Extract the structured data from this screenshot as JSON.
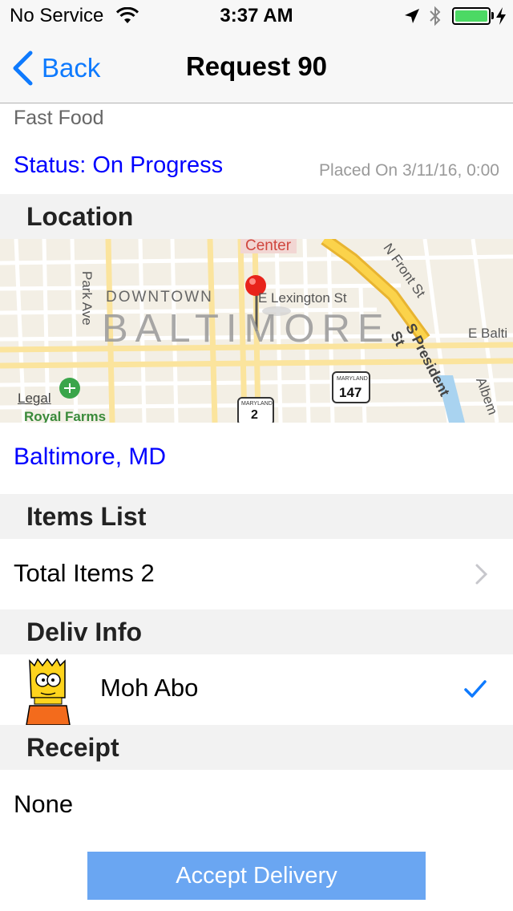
{
  "status_bar": {
    "carrier": "No Service",
    "time": "3:37 AM",
    "battery_color": "#4cd964",
    "icons": [
      "wifi-icon",
      "location-arrow-icon",
      "bluetooth-icon",
      "battery-icon",
      "charging-bolt-icon"
    ]
  },
  "nav": {
    "back_label": "Back",
    "title": "Request 90",
    "tint_color": "#0e7afe"
  },
  "request": {
    "category": "Fast Food",
    "status": "Status: On Progress",
    "placed_on": "Placed On 3/11/16, 0:00"
  },
  "location": {
    "header": "Location",
    "city": "Baltimore, MD",
    "map": {
      "district_label": "DOWNTOWN",
      "city_label": "BALTIMORE",
      "streets": [
        "Center",
        "Park Ave",
        "E Lexington St",
        "N Front St",
        "S President St",
        "E Balti",
        "Albem"
      ],
      "route_2_shield_top": "MARYLAND",
      "route_2_number": "2",
      "route_147_shield_top": "MARYLAND",
      "route_147_number": "147",
      "legal_label": "Legal",
      "poi_label": "Royal Farms",
      "pin_color": "#e8231b"
    }
  },
  "items": {
    "header": "Items List",
    "total_label": "Total Items 2"
  },
  "deliv_info": {
    "header": "Deliv Info",
    "name": "Moh Abo"
  },
  "receipt": {
    "header": "Receipt",
    "value": "None"
  },
  "actions": {
    "accept_label": "Accept Delivery",
    "accept_color": "#6aa6f2"
  }
}
